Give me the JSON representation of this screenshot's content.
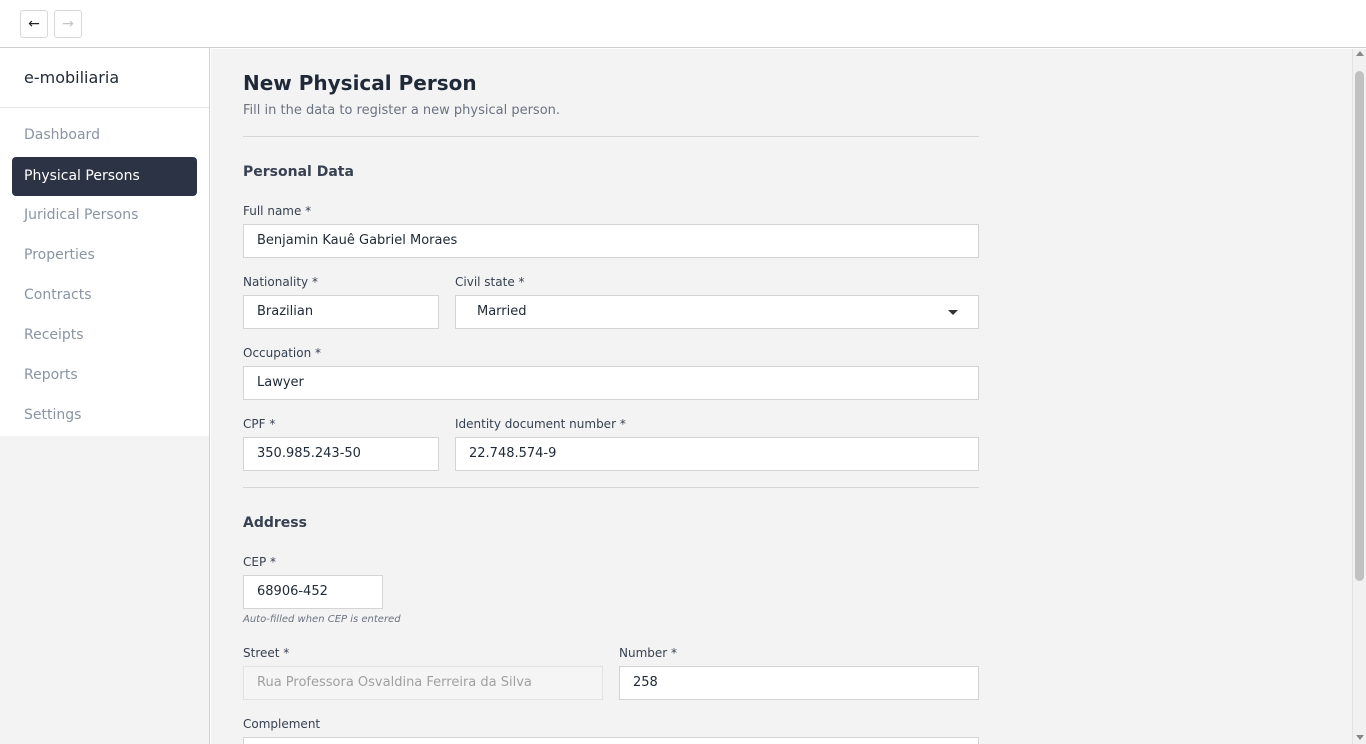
{
  "toolbar": {
    "back_icon": "arrow-left-icon",
    "back_glyph": "←",
    "forward_icon": "arrow-right-icon",
    "forward_glyph": "→"
  },
  "sidebar": {
    "brand": "e-mobiliaria",
    "items": [
      {
        "label": "Dashboard",
        "active": false
      },
      {
        "label": "Physical Persons",
        "active": true
      },
      {
        "label": "Juridical Persons",
        "active": false
      },
      {
        "label": "Properties",
        "active": false
      },
      {
        "label": "Contracts",
        "active": false
      },
      {
        "label": "Receipts",
        "active": false
      },
      {
        "label": "Reports",
        "active": false
      },
      {
        "label": "Settings",
        "active": false
      }
    ]
  },
  "page": {
    "title": "New Physical Person",
    "subtitle": "Fill in the data to register a new physical person."
  },
  "personal": {
    "section_title": "Personal Data",
    "full_name_label": "Full name *",
    "full_name_value": "Benjamin Kauê Gabriel Moraes",
    "nationality_label": "Nationality *",
    "nationality_value": "Brazilian",
    "civil_state_label": "Civil state *",
    "civil_state_value": "Married",
    "occupation_label": "Occupation *",
    "occupation_value": "Lawyer",
    "cpf_label": "CPF *",
    "cpf_value": "350.985.243-50",
    "identity_label": "Identity document number *",
    "identity_value": "22.748.574-9"
  },
  "address": {
    "section_title": "Address",
    "cep_label": "CEP *",
    "cep_value": "68906-452",
    "cep_hint": "Auto-filled when CEP is entered",
    "street_label": "Street *",
    "street_value": "Rua Professora Osvaldina Ferreira da Silva",
    "number_label": "Number *",
    "number_value": "258",
    "complement_label": "Complement",
    "complement_value": ""
  },
  "colors": {
    "active_nav_bg": "#2b3344",
    "page_bg": "#f3f3f3",
    "field_border": "#d4d4d4"
  }
}
